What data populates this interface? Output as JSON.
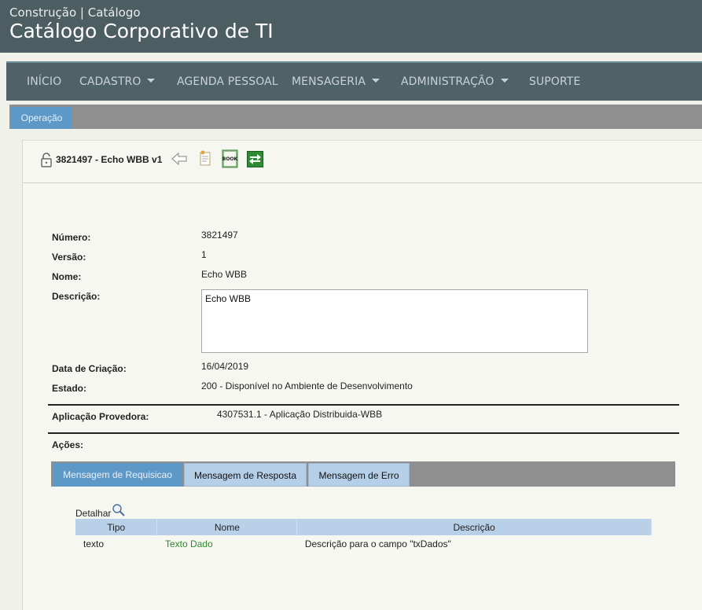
{
  "header": {
    "breadcrumb": "Construção | Catálogo",
    "title": "Catálogo Corporativo de TI"
  },
  "nav": {
    "items": [
      {
        "label": "INÍCIO"
      },
      {
        "label": "CADASTRO"
      },
      {
        "label": "AGENDA PESSOAL"
      },
      {
        "label": "MENSAGERIA"
      },
      {
        "label": "ADMINISTRAÇÃO"
      },
      {
        "label": "SUPORTE"
      }
    ]
  },
  "tabs": {
    "active": "Operação"
  },
  "record": {
    "heading": "3821497 - Echo WBB v1",
    "fields": {
      "numero_label": "Número:",
      "numero": "3821497",
      "versao_label": "Versão:",
      "versao": "1",
      "nome_label": "Nome:",
      "nome": "Echo WBB",
      "descricao_label": "Descrição:",
      "descricao": "Echo WBB",
      "data_label": "Data de Criação:",
      "data": "16/04/2019",
      "estado_label": "Estado:",
      "estado": "200 - Disponível no Ambiente de Desenvolvimento",
      "aplicacao_label": "Aplicação Provedora:",
      "aplicacao": "4307531.1 - Aplicação Distribuida-WBB",
      "acoes_label": "Ações:"
    }
  },
  "action_tabs": [
    {
      "label": "Mensagem de Requisicao",
      "active": true
    },
    {
      "label": "Mensagem de Resposta",
      "active": false
    },
    {
      "label": "Mensagem de Erro",
      "active": false
    }
  ],
  "detail": {
    "detalhar_label": "Detalhar",
    "columns": [
      "Tipo",
      "Nome",
      "Descrição"
    ],
    "rows": [
      {
        "tipo": "texto",
        "nome": "Texto Dado",
        "descricao": "Descrição para o campo \"txDados\""
      }
    ]
  },
  "icons": {
    "lock": "lock-icon",
    "back": "back-arrow-icon",
    "document": "document-icon",
    "book": "book-icon",
    "exchange": "exchange-icon",
    "search": "magnifier-icon"
  },
  "colors": {
    "topbar": "#4d5e63",
    "nav": "#4f6267",
    "tab_active": "#5d98c6",
    "tab_idle": "#b5cfe8",
    "link_green": "#2c8a2c"
  }
}
